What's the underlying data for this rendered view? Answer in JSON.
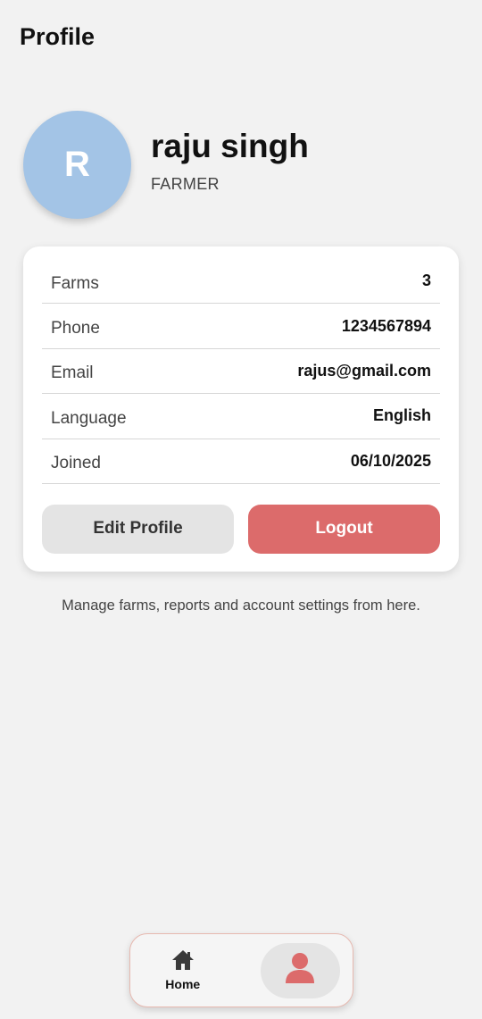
{
  "header": {
    "title": "Profile"
  },
  "profile": {
    "initial": "R",
    "name": "raju singh",
    "role": "FARMER"
  },
  "details": [
    {
      "label": "Farms",
      "value": "3"
    },
    {
      "label": "Phone",
      "value": "1234567894"
    },
    {
      "label": "Email",
      "value": "rajus@gmail.com"
    },
    {
      "label": "Language",
      "value": "English"
    },
    {
      "label": "Joined",
      "value": "06/10/2025"
    }
  ],
  "actions": {
    "edit_label": "Edit Profile",
    "logout_label": "Logout"
  },
  "help_text": "Manage farms, reports and account settings from here.",
  "nav": {
    "home_label": "Home",
    "home_icon": "home-icon",
    "profile_icon": "user-icon",
    "active": "profile"
  },
  "colors": {
    "avatar": "#a3c4e6",
    "logout": "#dc6b6b",
    "accent_icon": "#dc6b6b",
    "background": "#f2f2f2"
  }
}
